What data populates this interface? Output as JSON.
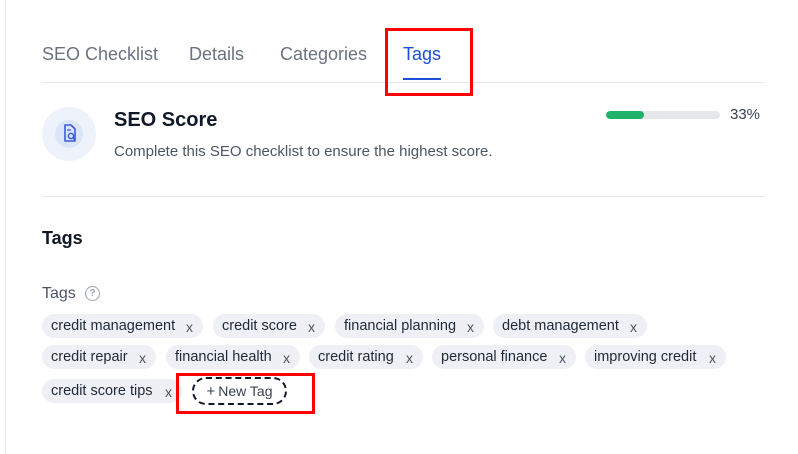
{
  "tabs": [
    {
      "label": "SEO Checklist"
    },
    {
      "label": "Details"
    },
    {
      "label": "Categories"
    },
    {
      "label": "Tags"
    }
  ],
  "active_tab": "Tags",
  "seo_score": {
    "title": "SEO Score",
    "description": "Complete this SEO checklist to ensure the highest score.",
    "progress_text": "33%",
    "progress_fraction": 0.33,
    "progress_color": "#21b26a",
    "icon": "seo-report-icon"
  },
  "tags_section": {
    "title": "Tags",
    "field_label": "Tags",
    "help_icon": "help-circle-icon",
    "tags": [
      "credit management",
      "credit score",
      "financial planning",
      "debt management",
      "credit repair",
      "financial health",
      "credit rating",
      "personal finance",
      "improving credit",
      "credit score tips"
    ],
    "remove_glyph": "x",
    "new_tag_plus": "+",
    "new_tag_label": "New Tag"
  },
  "colors": {
    "accent": "#1d4ed8",
    "highlight": "#ff0000",
    "tag_bg": "#eef0f5"
  }
}
